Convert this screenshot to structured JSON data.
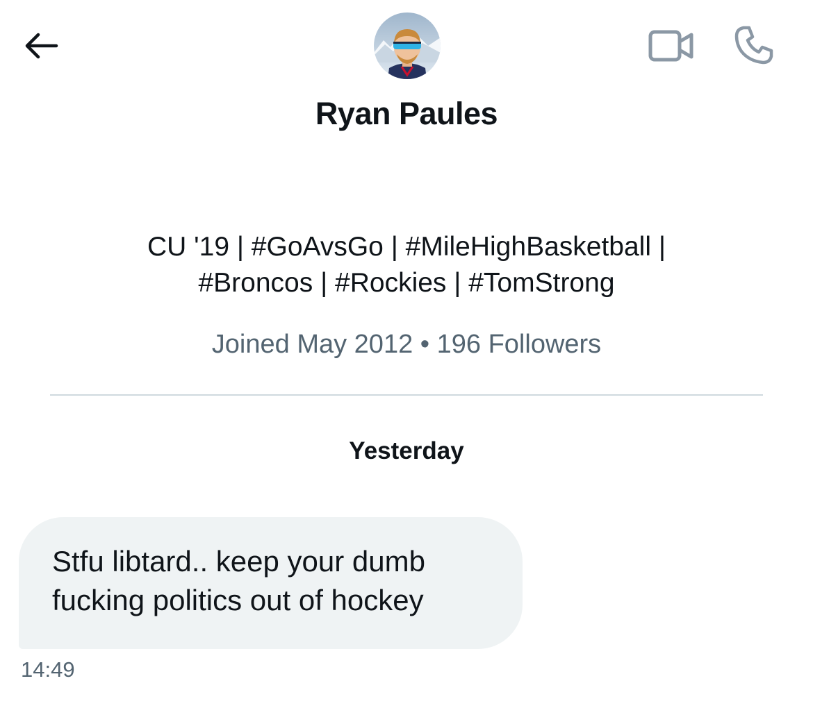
{
  "header": {
    "back_icon": "arrow-left-icon",
    "video_icon": "video-camera-icon",
    "phone_icon": "phone-icon"
  },
  "profile": {
    "avatar": "avatar",
    "display_name": "Ryan Paules",
    "bio_line_1": "CU '19 | #GoAvsGo | #MileHighBasketball |",
    "bio_line_2": "#Broncos | #Rockies | #TomStrong",
    "meta": "Joined May 2012 • 196 Followers"
  },
  "conversation": {
    "date_separator": "Yesterday",
    "messages": [
      {
        "text": "Stfu libtard.. keep your dumb\nfucking politics out of hockey",
        "time": "14:49"
      }
    ]
  },
  "colors": {
    "text_primary": "#0f1419",
    "text_secondary": "#536471",
    "bubble_bg": "#eff3f4",
    "divider": "#cfd9de",
    "icon_gray": "#8b98a5"
  }
}
